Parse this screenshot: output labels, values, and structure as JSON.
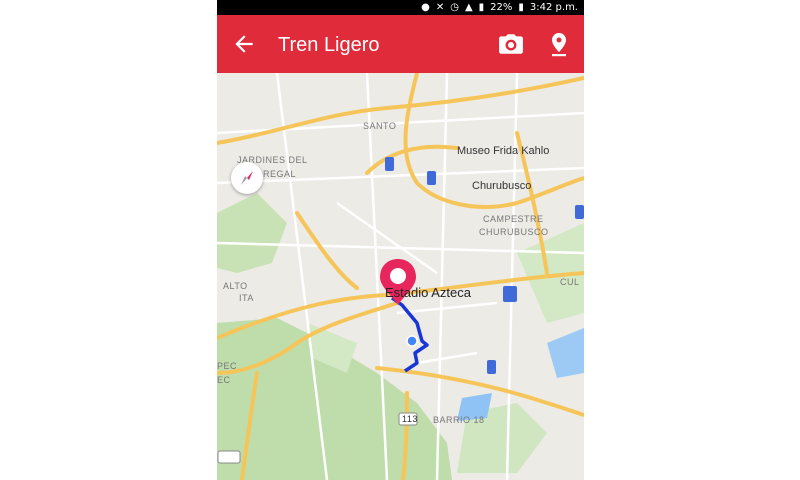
{
  "status_bar": {
    "battery": "22%",
    "time": "3:42 p.m."
  },
  "app_bar": {
    "title": "Tren Ligero",
    "back_icon": "arrow-left-icon",
    "camera_icon": "camera-icon",
    "location_icon": "location-pin-icon"
  },
  "map": {
    "labels": {
      "jardines": "JARDINES DEL",
      "pedregal": "PEDREGAL",
      "museo": "Museo Frida Kahlo",
      "churubusco": "Churubusco",
      "campestre": "CAMPESTRE",
      "campestre2": "CHURUBUSCO",
      "estadio": "Estadio Azteca",
      "culh": "CUL",
      "santa_ursula": "ALTO",
      "huipulco": "ITA",
      "pec": "PEC",
      "ec": "EC",
      "barrio": "BARRIO 18",
      "santo": "SANTO",
      "rd": "113"
    },
    "colors": {
      "road_major": "#f6c55a",
      "road_minor": "#ffffff",
      "green": "#c8e2b6",
      "water": "#8fc2f5",
      "route": "#1a35d6",
      "marker": "#e8265e",
      "transit": "#3f6ad8"
    }
  }
}
